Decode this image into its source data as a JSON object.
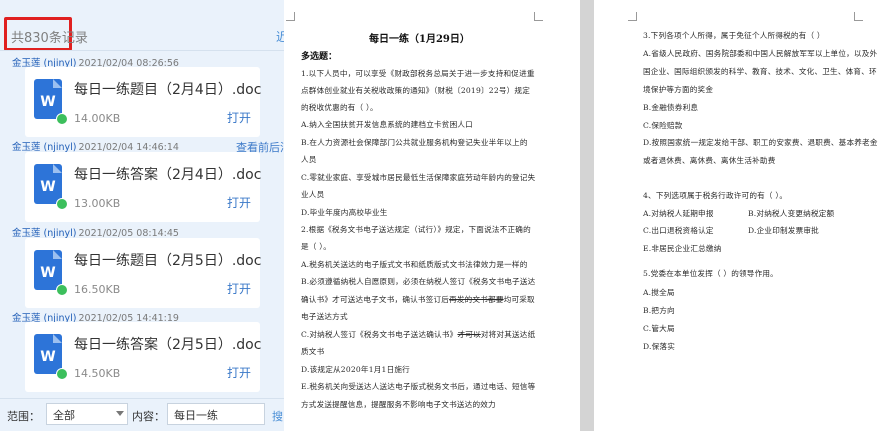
{
  "chat_history": {
    "record_count": "共830条记录",
    "recent_link": "近",
    "context_link": "查看前后消息",
    "messages": [
      {
        "sender": "金玉莲 (njinyl)",
        "timestamp": "2021/02/04 08:26:56",
        "file_name": "每日一练题目（2月4日）.doc",
        "file_size": "14.00KB",
        "action": "打开",
        "file_icon": "wps-writer-icon"
      },
      {
        "sender": "金玉莲 (njinyl)",
        "timestamp": "2021/02/04 14:46:14",
        "file_name": "每日一练答案（2月4日）.doc",
        "file_size": "13.00KB",
        "action": "打开",
        "file_icon": "wps-writer-icon"
      },
      {
        "sender": "金玉莲 (njinyl)",
        "timestamp": "2021/02/05 08:14:45",
        "file_name": "每日一练题目（2月5日）.doc",
        "file_size": "16.50KB",
        "action": "打开",
        "file_icon": "wps-writer-icon"
      },
      {
        "sender": "金玉莲 (njinyl)",
        "timestamp": "2021/02/05 14:41:19",
        "file_name": "每日一练答案（2月5日）.doc",
        "file_size": "14.50KB",
        "action": "打开",
        "file_icon": "wps-writer-icon"
      }
    ],
    "filter": {
      "range_label": "范围：",
      "range_value": "全部",
      "content_label": "内容：",
      "content_value": "每日一练",
      "search_label": "搜"
    }
  },
  "document": {
    "title": "每日一练（1月29日）",
    "section": "多选题：",
    "page1_lines": [
      "1.以下人员中，可以享受《财政部税务总局关于进一步支持和促进重",
      "点群体创业就业有关税收政策的通知》（财税〔2019〕22号）规定",
      "的税收优惠的有（      ）。",
      "A.纳入全国扶贫开发信息系统的建档立卡贫困人口",
      "B.在人力资源社会保障部门公共就业服务机构登记失业半年以上的",
      "人员",
      "C.零就业家庭、享受城市居民最低生活保障家庭劳动年龄内的登记失",
      "业人员",
      "D.毕业年度内高校毕业生",
      "2.根据《税务文书电子送达规定（试行）》规定，下面说法不正确的",
      "是（    ）。",
      "A.税务机关送达的电子版式文书和纸质版式文书法律效力是一样的",
      "B.必须遵循纳税人自愿原则，必须在纳税人签订《税务文书电子送达",
      "确认书》才可送达电子文书，确认书签订后",
      "C.对纳税人签订《税务文书电子送达确认书》",
      "质文书",
      "D.该规定从2020年1月1日施行",
      "E.税务机关向受送达人送达电子版式税务文书后，通过电话、短信等",
      "方式发送提醒信息，提醒服务不影响电子文书送达的效力"
    ],
    "page1_fragments": {
      "line14_strike": "再发的文书都要",
      "line14_tail": "均可采取",
      "line15_prefix": "电子送达方式",
      "line16_strike": "才可以",
      "line16_tail": "对将对其送达纸"
    },
    "page2_lines": [
      "3.下列各项个人所得，属于免征个人所得税的有（    ）",
      "A.省级人民政府、国务院部委和中国人民解放军军以上单位，以及外",
      "国企业、国际组织颁发的科学、教育、技术、文化、卫生、体育、环",
      "境保护等方面的奖金",
      "B.金融债券利息",
      "C.保险赔款",
      "D.按照国家统一规定发给干部、职工的安家费、退职费、基本养老金",
      "或者退休费、离休费、离休生活补助费",
      "4、下列选项属于税务行政许可的有（    ）。",
      "A.对纳税人延期申报",
      "B.对纳税人变更纳税定额",
      "C.出口退税资格认定",
      "D.企业印制发票审批",
      "E.非居民企业汇总缴纳",
      "5.党委在本单位发挥（  ）的领导作用。",
      "A.搅全局",
      "B.把方向",
      "C.管大局",
      "D.保落实"
    ]
  }
}
